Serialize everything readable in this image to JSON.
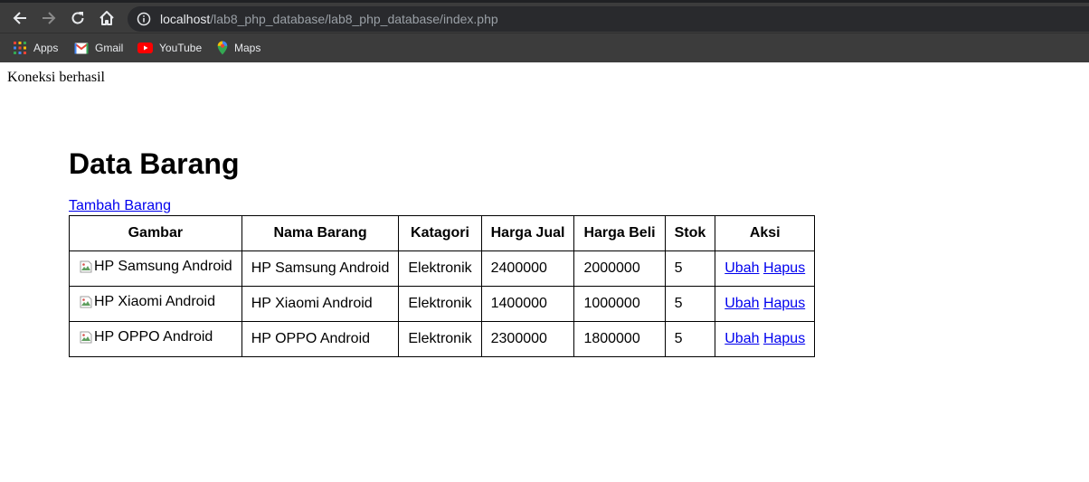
{
  "browser": {
    "url_host": "localhost",
    "url_path": "/lab8_php_database/lab8_php_database/index.php",
    "bookmarks": [
      {
        "label": "Apps",
        "icon": "apps-grid-icon"
      },
      {
        "label": "Gmail",
        "icon": "gmail-icon"
      },
      {
        "label": "YouTube",
        "icon": "youtube-icon"
      },
      {
        "label": "Maps",
        "icon": "maps-icon"
      }
    ]
  },
  "page": {
    "connection_message": "Koneksi berhasil",
    "title": "Data Barang",
    "add_link": "Tambah Barang",
    "table": {
      "headers": [
        "Gambar",
        "Nama Barang",
        "Katagori",
        "Harga Jual",
        "Harga Beli",
        "Stok",
        "Aksi"
      ],
      "rows": [
        {
          "gambar_alt": "HP Samsung Android",
          "nama": "HP Samsung Android",
          "kategori": "Elektronik",
          "harga_jual": "2400000",
          "harga_beli": "2000000",
          "stok": "5",
          "ubah": "Ubah",
          "hapus": "Hapus"
        },
        {
          "gambar_alt": "HP Xiaomi Android",
          "nama": "HP Xiaomi Android",
          "kategori": "Elektronik",
          "harga_jual": "1400000",
          "harga_beli": "1000000",
          "stok": "5",
          "ubah": "Ubah",
          "hapus": "Hapus"
        },
        {
          "gambar_alt": "HP OPPO Android",
          "nama": "HP OPPO Android",
          "kategori": "Elektronik",
          "harga_jual": "2300000",
          "harga_beli": "1800000",
          "stok": "5",
          "ubah": "Ubah",
          "hapus": "Hapus"
        }
      ]
    }
  }
}
